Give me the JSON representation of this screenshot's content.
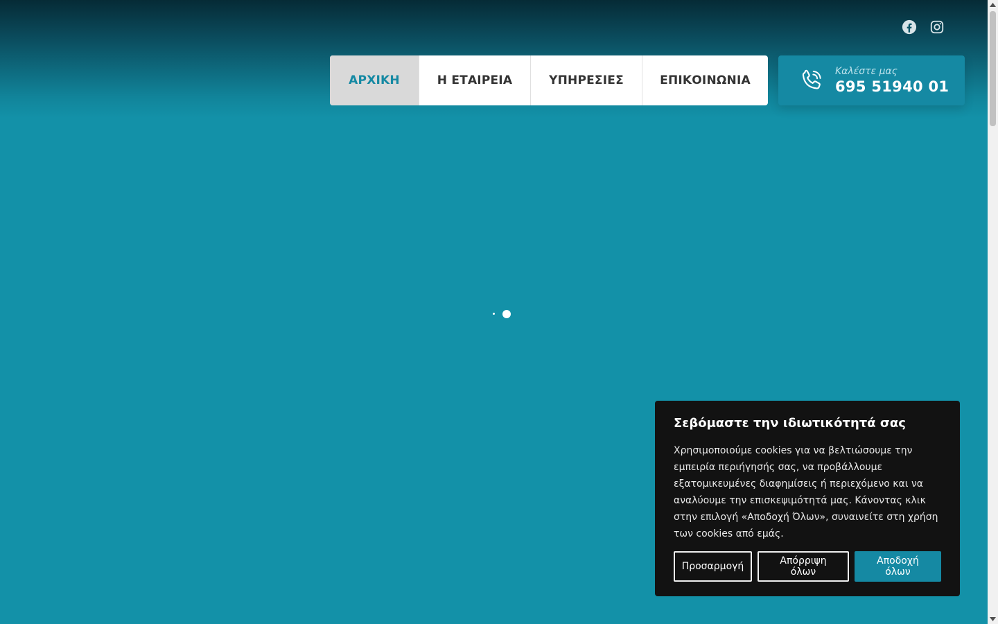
{
  "social": {
    "icons": [
      "facebook-icon",
      "instagram-icon"
    ]
  },
  "nav": {
    "items": [
      {
        "label": "ΑΡΧΙΚΗ",
        "active": true
      },
      {
        "label": "Η ΕΤΑΙΡΕΙΑ",
        "active": false
      },
      {
        "label": "ΥΠΗΡΕΣΙΕΣ",
        "active": false
      },
      {
        "label": "ΕΠΙΚΟΙΝΩΝΙΑ",
        "active": false
      }
    ]
  },
  "call": {
    "label": "Καλέστε μας",
    "number": "695 51940 01",
    "icon": "phone-icon"
  },
  "cookie": {
    "title": "Σεβόμαστε την ιδιωτικότητά σας",
    "text": "Χρησιμοποιούμε cookies για να βελτιώσουμε την εμπειρία περιήγησής σας, να προβάλλουμε εξατομικευμένες διαφημίσεις ή περιεχόμενο και να αναλύουμε την επισκεψιμότητά μας. Κάνοντας κλικ στην επιλογή «Αποδοχή Όλων», συναινείτε στη χρήση των cookies από εμάς.",
    "customize_label": "Προσαρμογή",
    "reject_label": "Απόρριψη όλων",
    "accept_label": "Αποδοχή όλων"
  },
  "colors": {
    "accent": "#1589a3",
    "background": "#1391a8",
    "dialog": "#121212"
  }
}
